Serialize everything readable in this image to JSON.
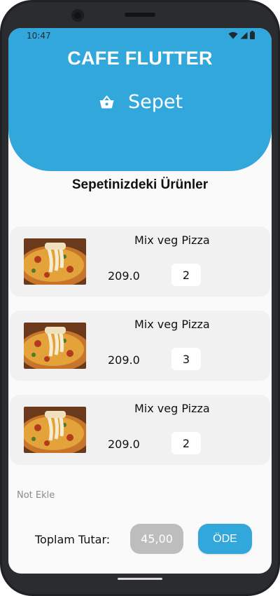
{
  "status_bar": {
    "time": "10:47",
    "icons": [
      "wifi-icon",
      "signal-icon",
      "battery-icon"
    ]
  },
  "header": {
    "title": "CAFE FLUTTER",
    "subtitle": "Sepet",
    "subtitle_icon": "basket-icon",
    "color": "#32a7dc"
  },
  "section_title": "Sepetinizdeki Ürünler",
  "cart": {
    "items": [
      {
        "name": "Mix veg Pizza",
        "price": "209.0",
        "quantity": "2",
        "image": "pizza-image"
      },
      {
        "name": "Mix veg Pizza",
        "price": "209.0",
        "quantity": "3",
        "image": "pizza-image"
      },
      {
        "name": "Mix veg Pizza",
        "price": "209.0",
        "quantity": "2",
        "image": "pizza-image"
      }
    ]
  },
  "note": {
    "label": "Not Ekle"
  },
  "footer": {
    "total_label": "Toplam Tutar:",
    "total_value": "45,00",
    "pay_label": "ÖDE"
  }
}
